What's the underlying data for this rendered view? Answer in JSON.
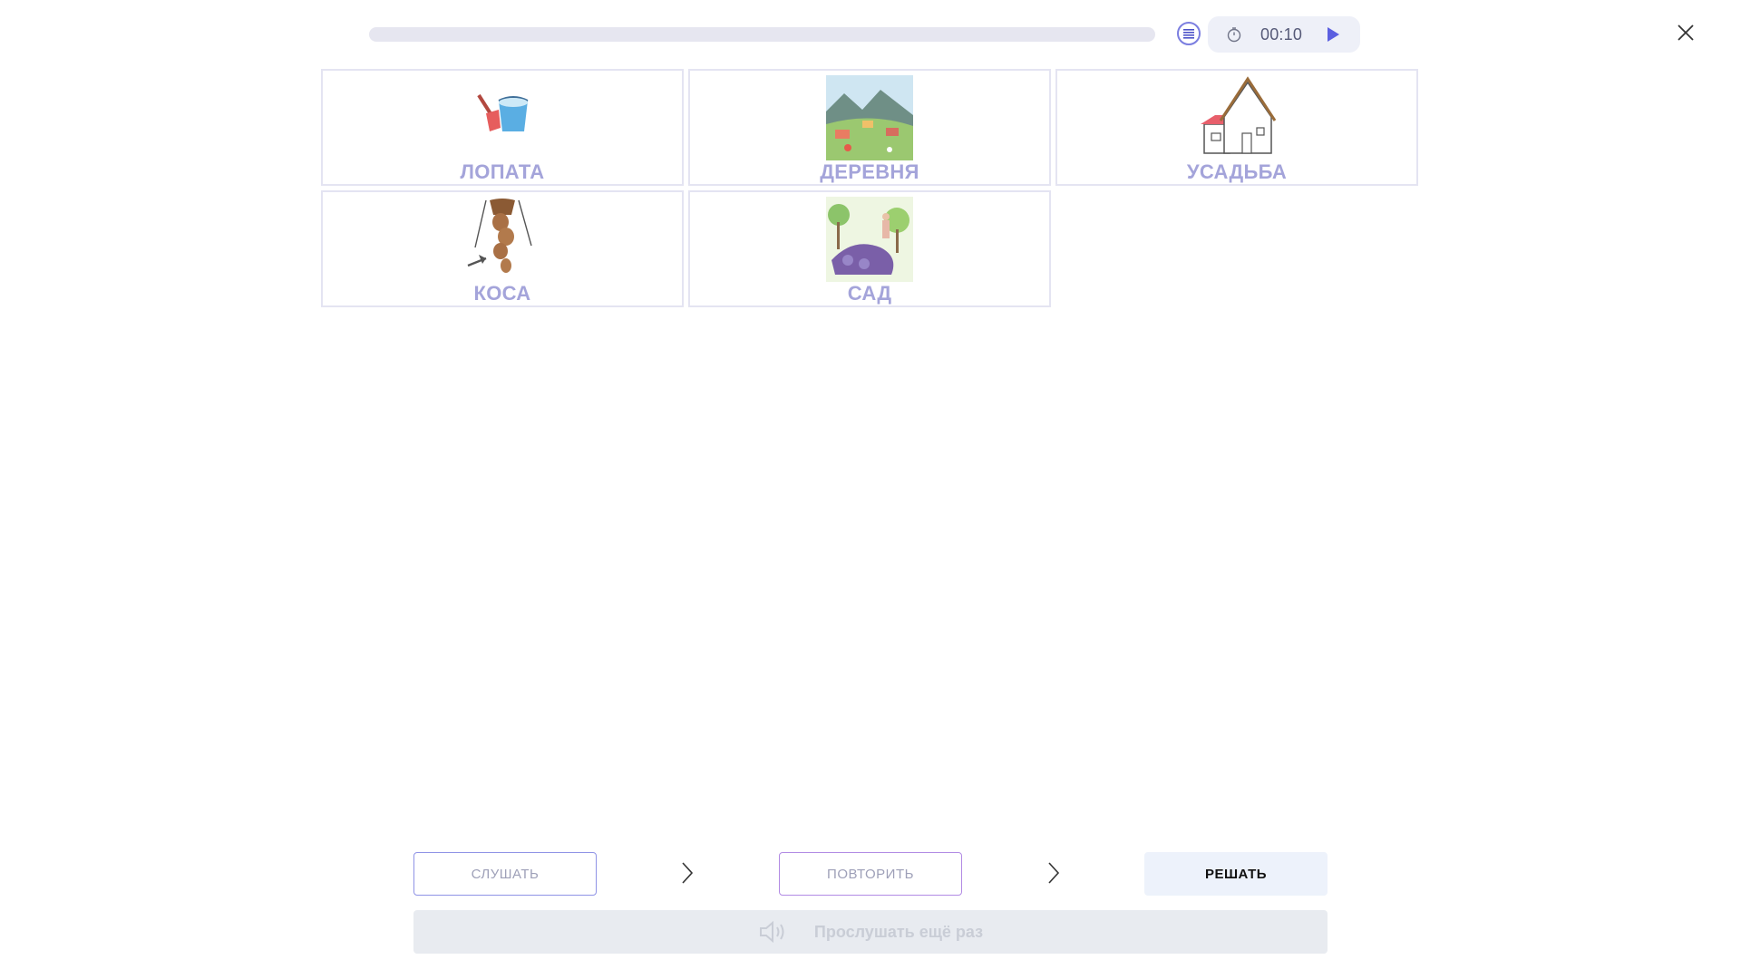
{
  "timer": {
    "value": "00:10"
  },
  "progress": {
    "fraction": 0.0
  },
  "cards": [
    {
      "label": "ЛОПАТА",
      "image": "shovel-bucket-icon"
    },
    {
      "label": "ДЕРЕВНЯ",
      "image": "village-landscape-picture"
    },
    {
      "label": "УСАДЬБА",
      "image": "house-icon"
    },
    {
      "label": "КОСА",
      "image": "braid-icon"
    },
    {
      "label": "САД",
      "image": "garden-picture"
    }
  ],
  "steps": {
    "listen": "СЛУШАТЬ",
    "repeat": "ПОВТОРИТЬ",
    "solve": "РЕШАТЬ"
  },
  "replay": {
    "label": "Прослушать ещё раз"
  },
  "colors": {
    "accent": "#7b7ee0",
    "card_label": "#a4a4da",
    "card_border": "#e4e4f2",
    "progress_track": "#e6e6f0"
  }
}
